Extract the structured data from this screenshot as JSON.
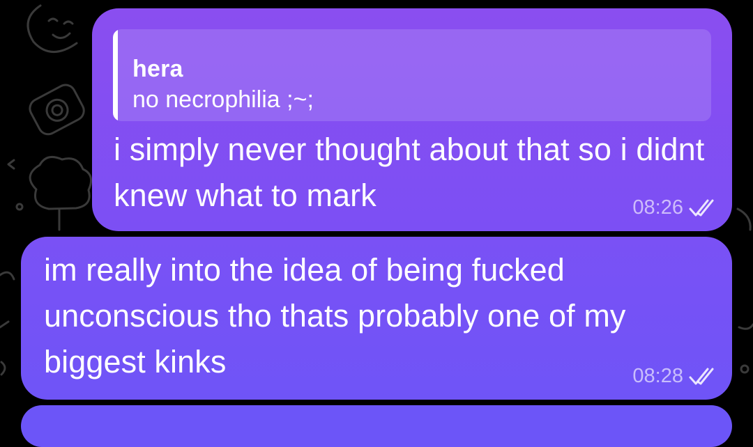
{
  "messages": [
    {
      "reply": {
        "name": "hera",
        "text": "no necrophilia ;~;"
      },
      "text": "i simply never thought about that so i didnt knew what to mark",
      "time": "08:26",
      "status_icon": "double-check-icon"
    },
    {
      "text": "im really into the idea of being fucked unconscious tho thats probably one of my biggest kinks",
      "time": "08:28",
      "status_icon": "double-check-icon"
    }
  ],
  "colors": {
    "background": "#000000",
    "bubble_top": "#8a4ef0",
    "bubble_bottom": "#6f54f7",
    "meta_text": "rgba(255,255,255,0.62)"
  }
}
